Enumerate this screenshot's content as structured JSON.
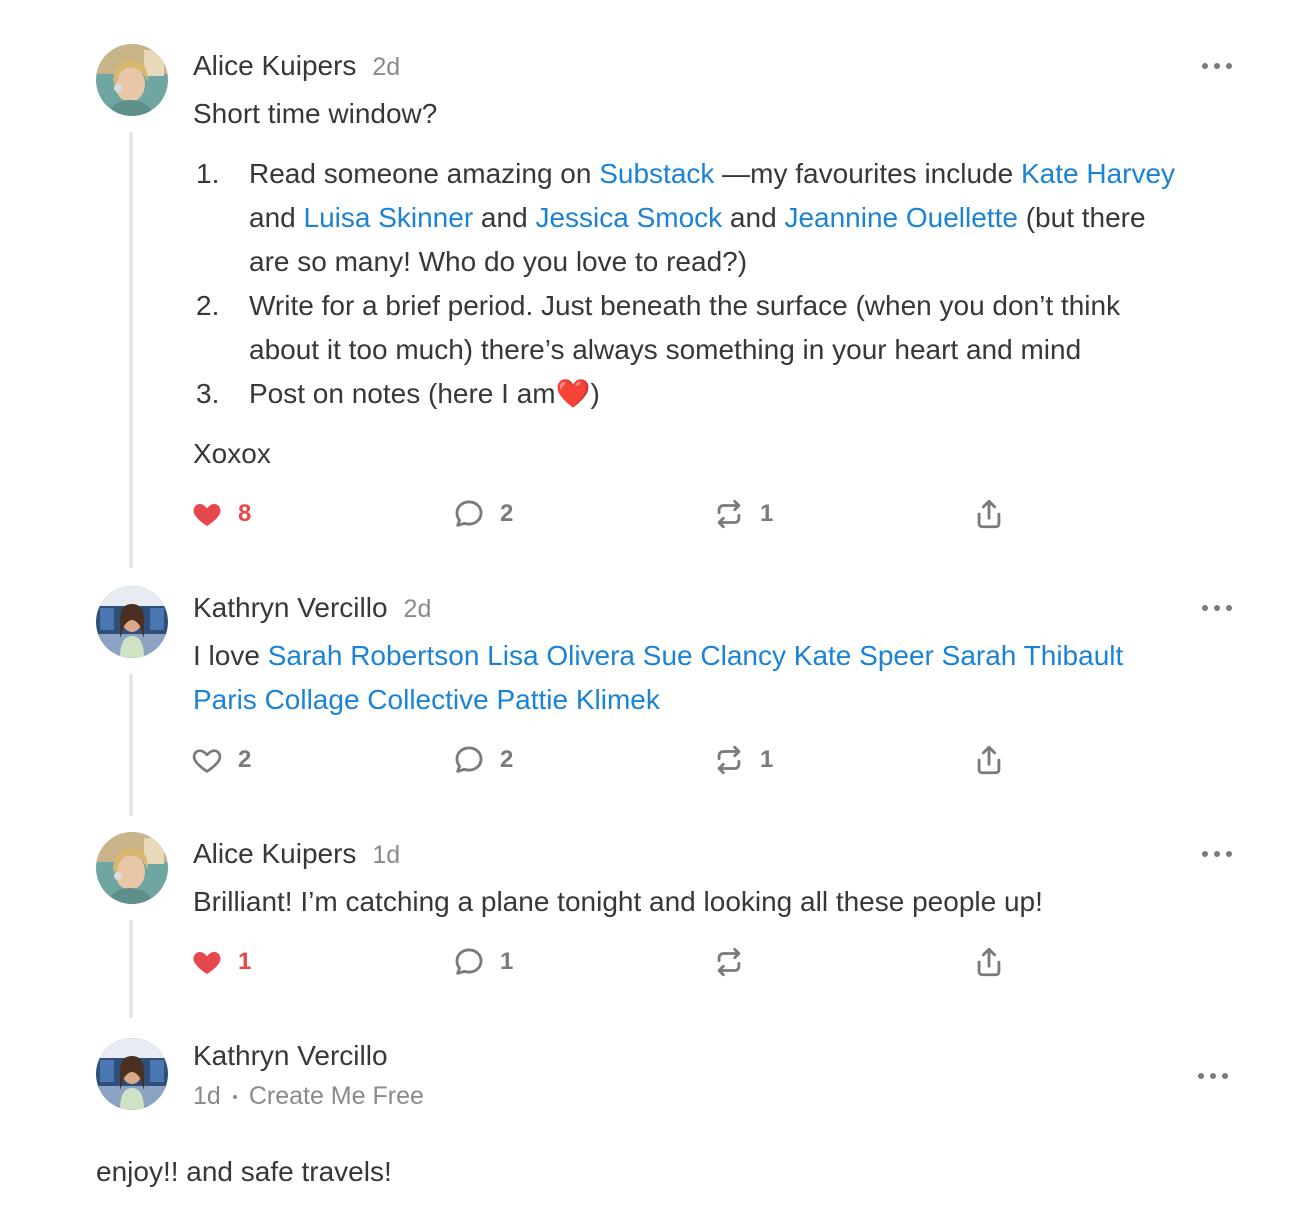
{
  "comments": [
    {
      "author": "Alice Kuipers",
      "time": "2d",
      "intro": "Short time window?",
      "list": [
        {
          "num": "1.",
          "lines": [
            [
              {
                "t": "Read someone amazing on "
              },
              {
                "t": "Substack",
                "link": true
              },
              {
                "t": " —my favourites include "
              },
              {
                "t": "Kate Harvey",
                "link": true
              }
            ],
            [
              {
                "t": "and "
              },
              {
                "t": "Luisa Skinner",
                "link": true
              },
              {
                "t": " and "
              },
              {
                "t": "Jessica Smock",
                "link": true
              },
              {
                "t": " and "
              },
              {
                "t": "Jeannine Ouellette",
                "link": true
              },
              {
                "t": " (but there"
              }
            ],
            [
              {
                "t": "are so many! Who do you love to read?)"
              }
            ]
          ]
        },
        {
          "num": "2.",
          "lines": [
            [
              {
                "t": "Write for a brief period. Just beneath the surface (when you don’t think"
              }
            ],
            [
              {
                "t": "about it too much) there’s always something in your heart and mind"
              }
            ]
          ]
        },
        {
          "num": "3.",
          "lines": [
            [
              {
                "t": "Post on notes (here I am❤️)"
              }
            ]
          ]
        }
      ],
      "outro": "Xoxox",
      "likes": "8",
      "liked": true,
      "replies": "2",
      "restacks": "1"
    },
    {
      "author": "Kathryn Vercillo",
      "time": "2d",
      "lines": [
        [
          {
            "t": "I love "
          },
          {
            "t": "Sarah Robertson",
            "link": true
          },
          {
            "t": " "
          },
          {
            "t": "Lisa Olivera",
            "link": true
          },
          {
            "t": " "
          },
          {
            "t": "Sue Clancy",
            "link": true
          },
          {
            "t": " "
          },
          {
            "t": "Kate Speer",
            "link": true
          },
          {
            "t": " "
          },
          {
            "t": "Sarah Thibault",
            "link": true
          }
        ],
        [
          {
            "t": "Paris Collage Collective",
            "link": true
          },
          {
            "t": " "
          },
          {
            "t": "Pattie Klimek",
            "link": true
          }
        ]
      ],
      "likes": "2",
      "liked": false,
      "replies": "2",
      "restacks": "1"
    },
    {
      "author": "Alice Kuipers",
      "time": "1d",
      "text": "Brilliant! I’m catching a plane tonight and looking all these people up!",
      "likes": "1",
      "liked": true,
      "replies": "1",
      "restacks": ""
    },
    {
      "author": "Kathryn Vercillo",
      "time": "1d",
      "publication": "Create Me Free",
      "text": "enjoy!! and safe travels!"
    }
  ],
  "colors": {
    "link": "#1a83d6",
    "liked": "#e5484d",
    "muted": "#7a7a7a",
    "text": "#363737"
  },
  "icons": [
    "heart-icon",
    "comment-icon",
    "restack-icon",
    "share-icon",
    "more-icon"
  ]
}
